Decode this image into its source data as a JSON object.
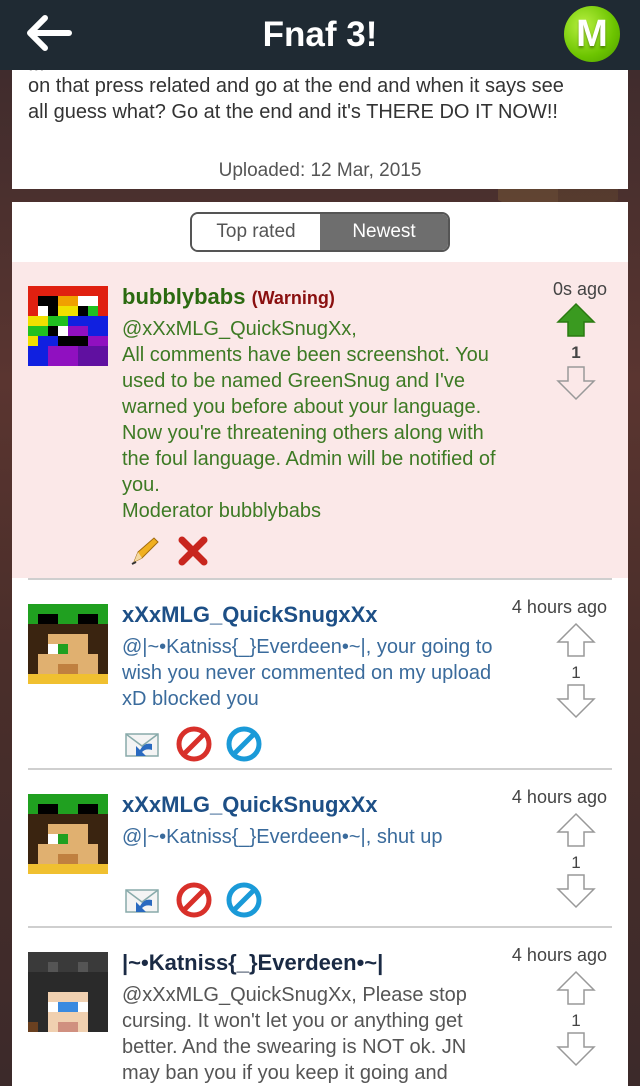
{
  "header": {
    "title": "Fnaf 3!",
    "badge_letter": "M"
  },
  "description": {
    "cut_line": "...",
    "lines": [
      "on that press related and go at the end and when it says see",
      "all guess what? Go at the end and it's THERE DO IT NOW!!"
    ],
    "uploaded": "Uploaded: 12 Mar, 2015"
  },
  "sort_tabs": {
    "top_rated": "Top rated",
    "newest": "Newest",
    "selected": "Newest"
  },
  "comments": [
    {
      "user": "bubblybabs",
      "tag": "(Warning)",
      "time": "0s ago",
      "votes": "1",
      "body": [
        "@xXxMLG_QuickSnugXx,",
        "All comments have been screenshot. You",
        "used to be named GreenSnug and I've",
        "warned you before about your language.",
        "Now you're threatening others along with",
        "the foul language. Admin will be notified of",
        "you.",
        "Moderator bubblybabs"
      ]
    },
    {
      "user": "xXxMLG_QuickSnugxXx",
      "time": "4 hours ago",
      "votes": "1",
      "body": [
        "@|~•Katniss{_}Everdeen•~|, your going to",
        "wish you never commented on my upload",
        "xD blocked you"
      ]
    },
    {
      "user": "xXxMLG_QuickSnugxXx",
      "time": "4 hours ago",
      "votes": "1",
      "body": [
        "@|~•Katniss{_}Everdeen•~|, shut up"
      ]
    },
    {
      "user": "|~•Katniss{_}Everdeen•~|",
      "time": "4 hours ago",
      "votes": "1",
      "body": [
        "@xXxMLG_QuickSnugXx, Please stop",
        "cursing. It won't let you or anything get",
        "better. And the swearing is NOT ok. JN",
        "may ban you if you keep it going and"
      ]
    }
  ]
}
